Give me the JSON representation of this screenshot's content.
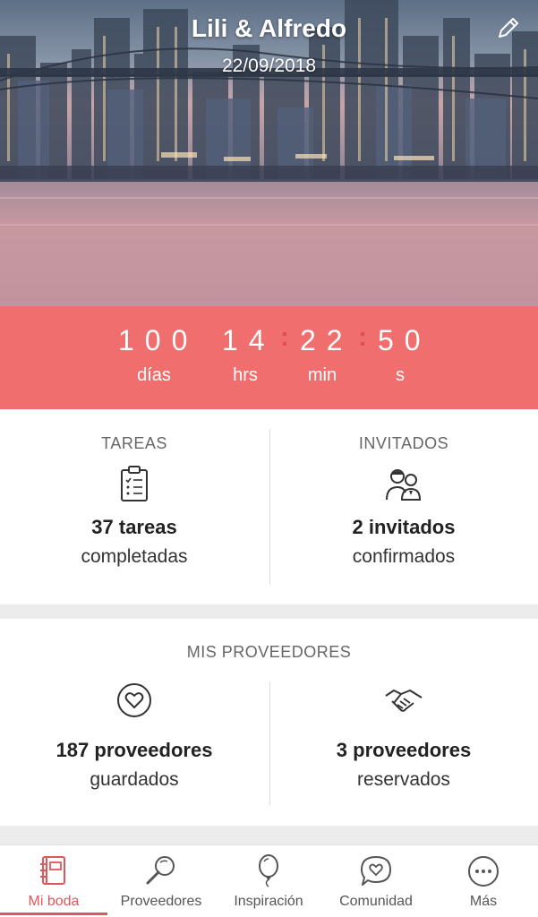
{
  "header": {
    "title": "Lili & Alfredo",
    "date": "22/09/2018",
    "edit_icon": "pencil-icon"
  },
  "countdown": {
    "days": "100",
    "hours": "14",
    "minutes": "22",
    "seconds": "50",
    "days_label": "días",
    "hours_label": "hrs",
    "minutes_label": "min",
    "seconds_label": "s",
    "separator": ":"
  },
  "summary": {
    "tasks": {
      "heading": "TAREAS",
      "count": "37 tareas",
      "status": "completadas",
      "icon": "clipboard-checklist-icon"
    },
    "guests": {
      "heading": "INVITADOS",
      "count": "2 invitados",
      "status": "confirmados",
      "icon": "couple-icon"
    }
  },
  "vendors": {
    "heading": "MIS PROVEEDORES",
    "saved": {
      "count": "187 proveedores",
      "status": "guardados",
      "icon": "heart-circle-icon"
    },
    "booked": {
      "count": "3 proveedores",
      "status": "reservados",
      "icon": "handshake-icon"
    }
  },
  "nav": {
    "items": [
      {
        "label": "Mi boda",
        "icon": "notebook-icon",
        "active": true
      },
      {
        "label": "Proveedores",
        "icon": "magnifier-icon",
        "active": false
      },
      {
        "label": "Inspiración",
        "icon": "balloon-icon",
        "active": false
      },
      {
        "label": "Comunidad",
        "icon": "chat-heart-icon",
        "active": false
      },
      {
        "label": "Más",
        "icon": "more-dots-icon",
        "active": false
      }
    ],
    "accent": "#e0565a"
  },
  "colors": {
    "countdown_bg": "#f06e6e",
    "accent": "#e0565a"
  }
}
